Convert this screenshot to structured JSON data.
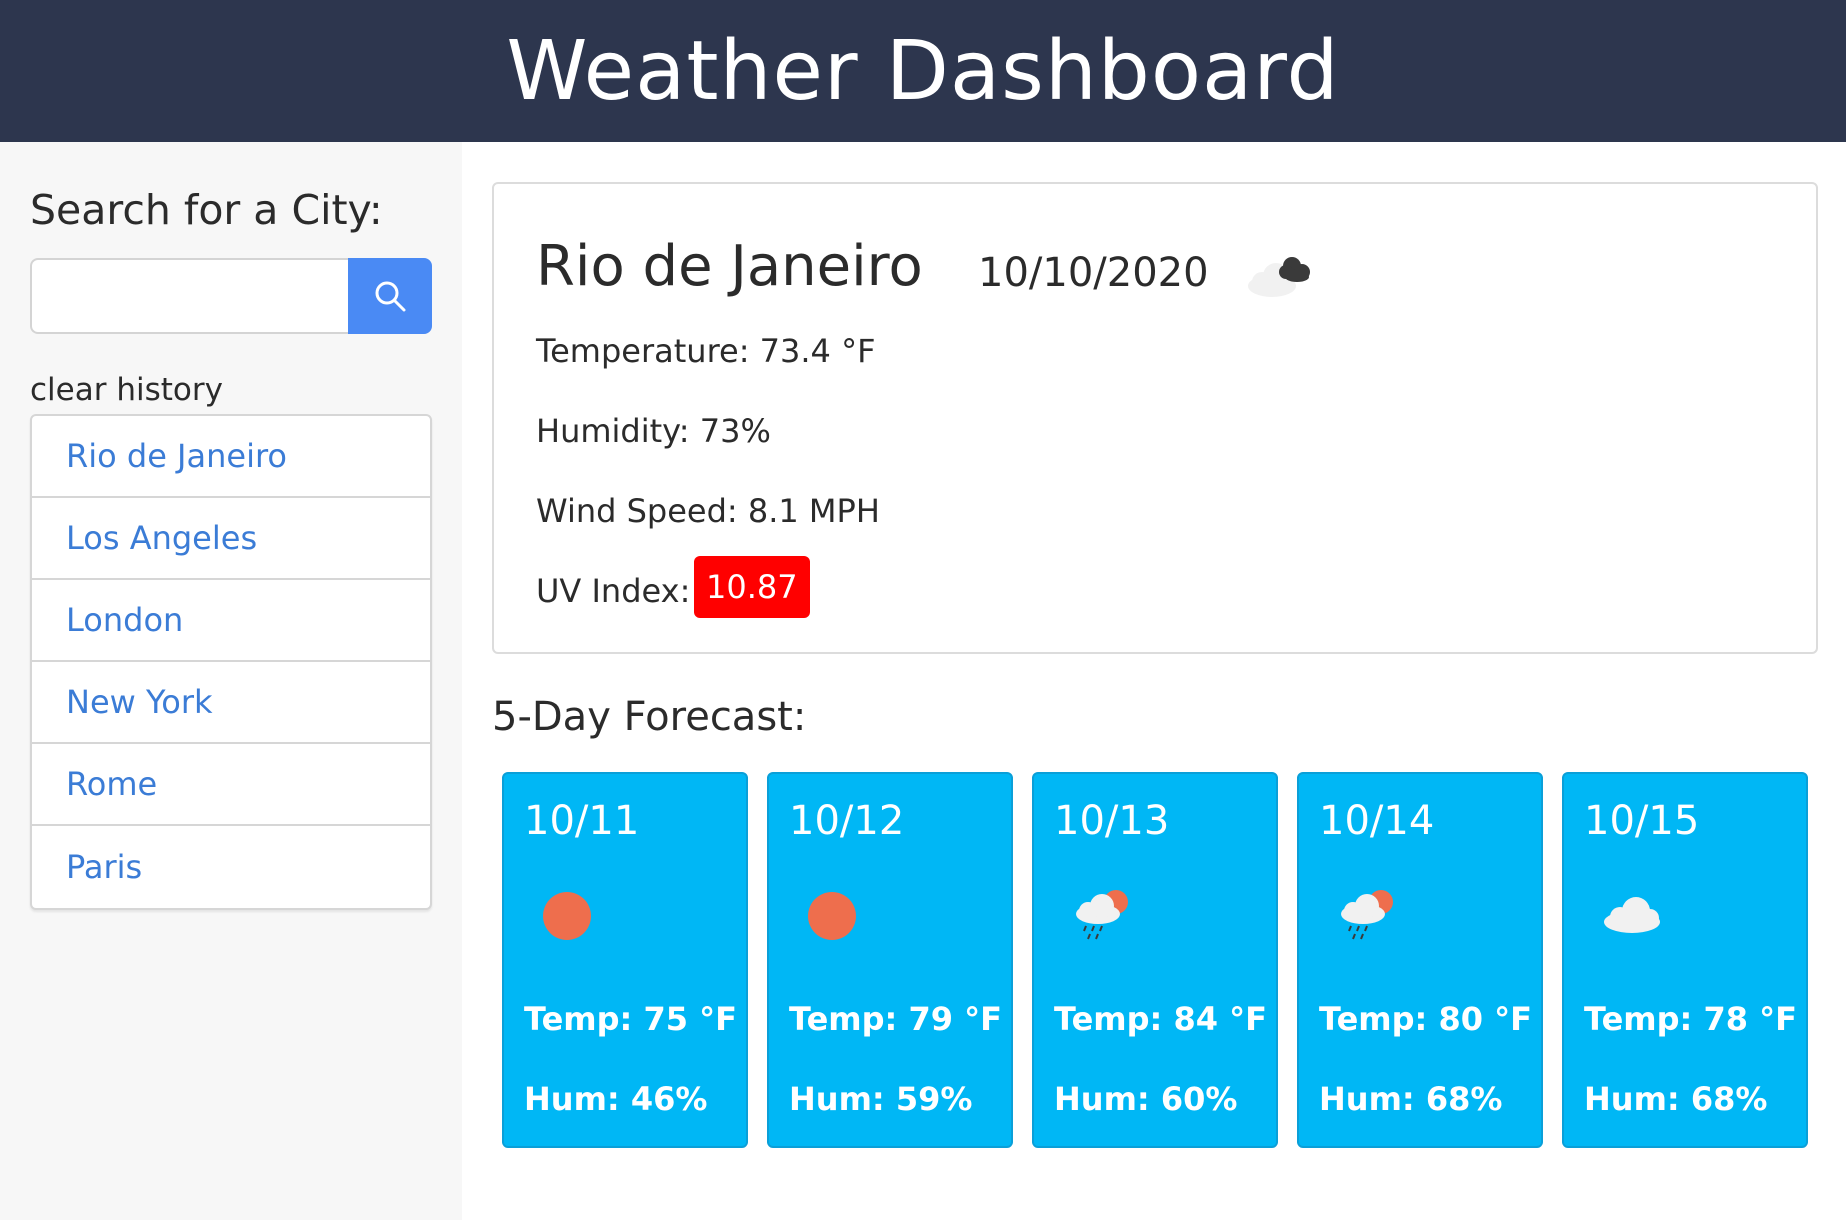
{
  "header": {
    "title": "Weather Dashboard"
  },
  "sidebar": {
    "search_title": "Search for a City:",
    "search_input": {
      "value": "",
      "placeholder": ""
    },
    "search_button_icon": "search-icon",
    "clear_history_label": "clear history",
    "history": [
      "Rio de Janeiro",
      "Los Angeles",
      "London",
      "New York",
      "Rome",
      "Paris"
    ]
  },
  "current": {
    "city": "Rio de Janeiro",
    "date": "10/10/2020",
    "icon": "cloudy-night-icon",
    "temperature": "Temperature: 73.4 °F",
    "humidity": "Humidity: 73%",
    "wind": "Wind Speed: 8.1 MPH",
    "uv_label": "UV Index:",
    "uv_value": "10.87",
    "uv_color": "#ff0000"
  },
  "forecast": {
    "title": "5-Day Forecast:",
    "days": [
      {
        "date": "10/11",
        "icon": "sun-icon",
        "temp": "Temp: 75 °F",
        "hum": "Hum: 46%"
      },
      {
        "date": "10/12",
        "icon": "sun-icon",
        "temp": "Temp: 79 °F",
        "hum": "Hum: 59%"
      },
      {
        "date": "10/13",
        "icon": "rain-sun-icon",
        "temp": "Temp: 84 °F",
        "hum": "Hum: 60%"
      },
      {
        "date": "10/14",
        "icon": "rain-sun-icon",
        "temp": "Temp: 80 °F",
        "hum": "Hum: 68%"
      },
      {
        "date": "10/15",
        "icon": "cloud-icon",
        "temp": "Temp: 78 °F",
        "hum": "Hum: 68%"
      }
    ]
  },
  "colors": {
    "header_bg": "#2d364e",
    "accent_blue": "#4a8af4",
    "link_blue": "#3b7cd6",
    "forecast_card": "#00b7f5",
    "uv_high": "#ff0000"
  }
}
